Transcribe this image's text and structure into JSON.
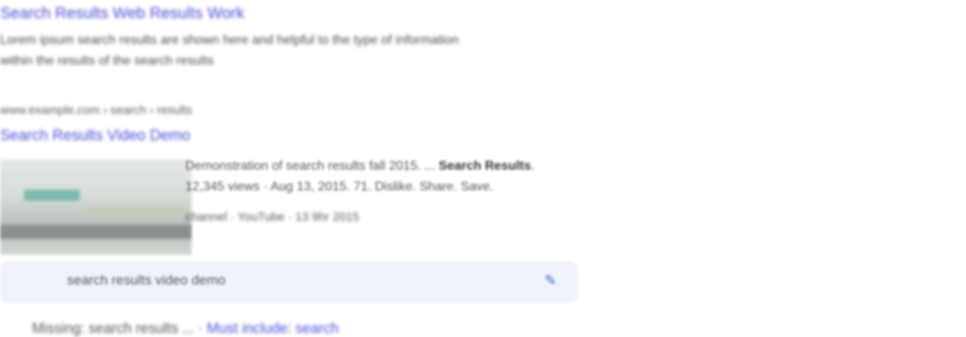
{
  "result1": {
    "title": "Search Results Web Results Work",
    "snippet_line1": "Lorem ipsum search results are shown here and helpful to the type of information",
    "snippet_line2": "within the results of the search results"
  },
  "result2": {
    "breadcrumb": "www.example.com › search › results",
    "title": "Search Results Video Demo"
  },
  "video": {
    "line1_prefix": "Demonstration of search results fall 2015. ...",
    "line1_bold": "Search Results",
    "line1_suffix": ".",
    "line2": "12,345 views · Aug 13, 2015. 71. Dislike. Share. Save.",
    "line3": "channel · YouTube · 13 9hr 2015"
  },
  "related_search": {
    "query": "search results video demo",
    "edit_icon": "pencil-icon"
  },
  "bottom": {
    "prefix": "Missing: search results ... ·",
    "link": "Must include: search"
  }
}
